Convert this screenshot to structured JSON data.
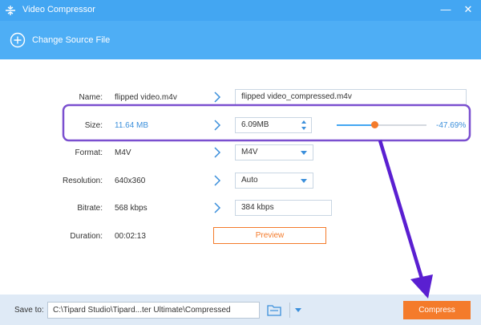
{
  "window": {
    "title": "Video Compressor",
    "minimize_glyph": "—",
    "close_glyph": "✕"
  },
  "toolbar": {
    "change_source_label": "Change Source File"
  },
  "fields": {
    "name": {
      "label": "Name:",
      "source": "flipped video.m4v",
      "output": "flipped video_compressed.m4v"
    },
    "size": {
      "label": "Size:",
      "source": "11.64 MB",
      "output": "6.09MB",
      "percent": "-47.69%",
      "slider_fraction": 0.42
    },
    "format": {
      "label": "Format:",
      "source": "M4V",
      "output": "M4V"
    },
    "resolution": {
      "label": "Resolution:",
      "source": "640x360",
      "output": "Auto"
    },
    "bitrate": {
      "label": "Bitrate:",
      "source": "568 kbps",
      "output": "384 kbps"
    },
    "duration": {
      "label": "Duration:",
      "source": "00:02:13"
    }
  },
  "preview_label": "Preview",
  "footer": {
    "save_to_label": "Save to:",
    "path": "C:\\Tipard Studio\\Tipard...ter Ultimate\\Compressed",
    "compress_label": "Compress"
  },
  "colors": {
    "titlebar": "#43a6f2",
    "toolbar": "#4eaef5",
    "accent_blue": "#3b8fdb",
    "accent_orange": "#f47b2b",
    "highlight_purple": "#7a4fcf",
    "annotation_arrow": "#5a1fd1"
  },
  "icons": {
    "app": "compress-app-icon",
    "add": "plus-circle-icon",
    "arrow": "chevron-right-icon",
    "folder": "folder-icon"
  }
}
